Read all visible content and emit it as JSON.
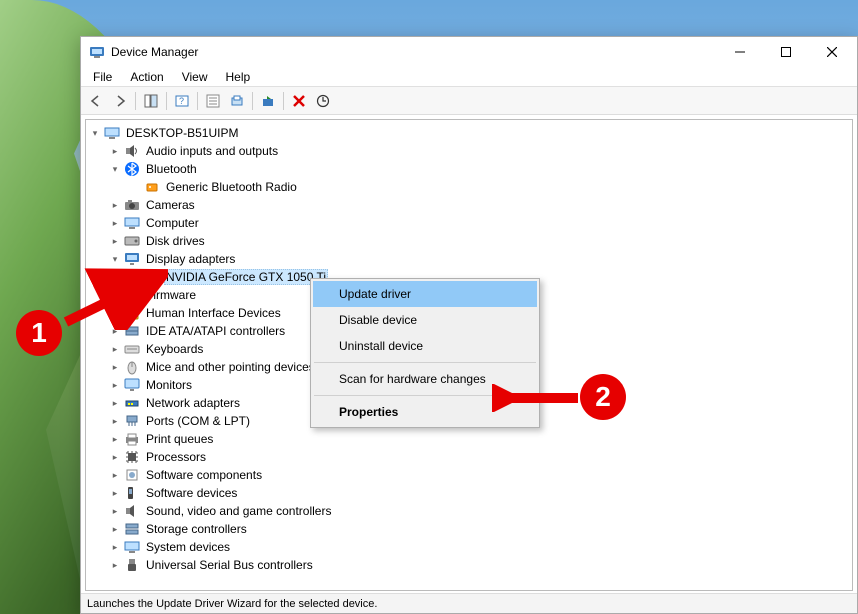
{
  "window": {
    "title": "Device Manager"
  },
  "menubar": {
    "file": "File",
    "action": "Action",
    "view": "View",
    "help": "Help"
  },
  "tree": {
    "root": "DESKTOP-B51UIPM",
    "nodes": [
      {
        "label": "Audio inputs and outputs",
        "expandable": true
      },
      {
        "label": "Bluetooth",
        "expanded": true,
        "children": [
          {
            "label": "Generic Bluetooth Radio"
          }
        ]
      },
      {
        "label": "Cameras",
        "expandable": true
      },
      {
        "label": "Computer",
        "expandable": true
      },
      {
        "label": "Disk drives",
        "expandable": true
      },
      {
        "label": "Display adapters",
        "expanded": true,
        "children": [
          {
            "label": "NVIDIA GeForce GTX 1050 Ti",
            "selected": true
          }
        ]
      },
      {
        "label": "Firmware",
        "expandable": true
      },
      {
        "label": "Human Interface Devices",
        "expandable": true
      },
      {
        "label": "IDE ATA/ATAPI controllers",
        "expandable": true
      },
      {
        "label": "Keyboards",
        "expandable": true
      },
      {
        "label": "Mice and other pointing devices",
        "expandable": true
      },
      {
        "label": "Monitors",
        "expandable": true
      },
      {
        "label": "Network adapters",
        "expandable": true
      },
      {
        "label": "Ports (COM & LPT)",
        "expandable": true
      },
      {
        "label": "Print queues",
        "expandable": true
      },
      {
        "label": "Processors",
        "expandable": true
      },
      {
        "label": "Software components",
        "expandable": true
      },
      {
        "label": "Software devices",
        "expandable": true
      },
      {
        "label": "Sound, video and game controllers",
        "expandable": true
      },
      {
        "label": "Storage controllers",
        "expandable": true
      },
      {
        "label": "System devices",
        "expandable": true
      },
      {
        "label": "Universal Serial Bus controllers",
        "expandable": true
      }
    ]
  },
  "context_menu": {
    "update_driver": "Update driver",
    "disable_device": "Disable device",
    "uninstall_device": "Uninstall device",
    "scan_hardware": "Scan for hardware changes",
    "properties": "Properties"
  },
  "statusbar": {
    "text": "Launches the Update Driver Wizard for the selected device."
  },
  "annotations": {
    "one": "1",
    "two": "2"
  }
}
